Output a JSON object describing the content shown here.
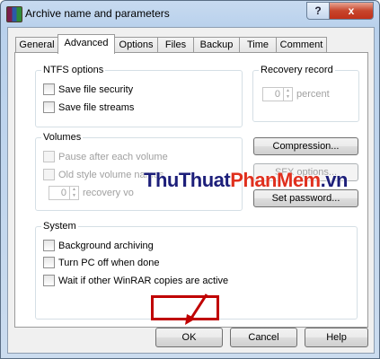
{
  "window": {
    "title": "Archive name and parameters",
    "help_button": "?",
    "close_button": "x"
  },
  "tabs": [
    {
      "label": "General"
    },
    {
      "label": "Advanced"
    },
    {
      "label": "Options"
    },
    {
      "label": "Files"
    },
    {
      "label": "Backup"
    },
    {
      "label": "Time"
    },
    {
      "label": "Comment"
    }
  ],
  "ntfs": {
    "title": "NTFS options",
    "save_security": "Save file security",
    "save_streams": "Save file streams"
  },
  "recovery": {
    "title": "Recovery record",
    "value": "0",
    "unit": "percent"
  },
  "volumes": {
    "title": "Volumes",
    "pause": "Pause after each volume",
    "old_style": "Old style volume names",
    "value": "0",
    "unit": "recovery vo"
  },
  "buttons": {
    "compression": "Compression...",
    "sfx": "SFX options...",
    "set_password": "Set password...",
    "ok": "OK",
    "cancel": "Cancel",
    "help": "Help"
  },
  "system": {
    "title": "System",
    "background": "Background archiving",
    "turn_off": "Turn PC off when done",
    "wait": "Wait if other WinRAR copies are active"
  },
  "watermark": {
    "part1": "ThuThuat",
    "part2": "PhanMem",
    "part3": ".vn"
  },
  "colors": {
    "highlight": "#c00000",
    "watermark_dark": "#1d1f7a",
    "watermark_red": "#e0301e"
  }
}
